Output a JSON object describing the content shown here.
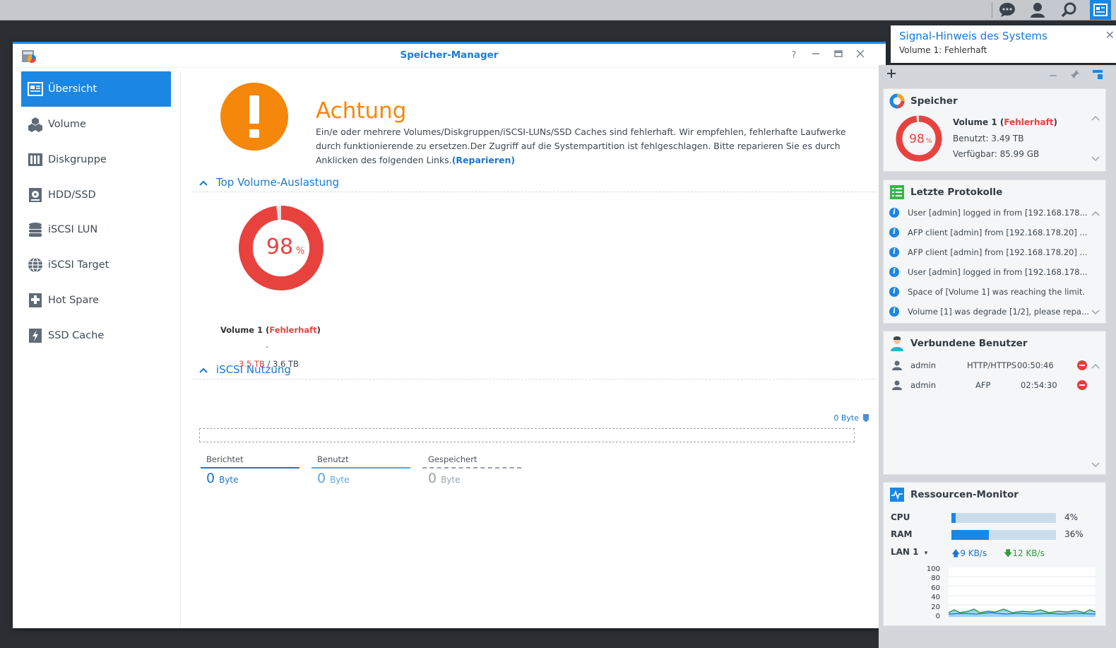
{
  "window": {
    "title": "Speicher-Manager",
    "help": "?"
  },
  "sidebar": {
    "items": [
      {
        "label": "Übersicht",
        "icon": "overview-icon",
        "active": true
      },
      {
        "label": "Volume",
        "icon": "cubes-icon"
      },
      {
        "label": "Diskgruppe",
        "icon": "disk-group-icon"
      },
      {
        "label": "HDD/SSD",
        "icon": "hdd-icon"
      },
      {
        "label": "iSCSI LUN",
        "icon": "database-icon"
      },
      {
        "label": "iSCSI Target",
        "icon": "globe-icon"
      },
      {
        "label": "Hot Spare",
        "icon": "hot-spare-icon"
      },
      {
        "label": "SSD Cache",
        "icon": "ssd-cache-icon"
      }
    ]
  },
  "warning": {
    "heading": "Achtung",
    "text": "Ein/e oder mehrere Volumes/Diskgruppen/iSCSI-LUNs/SSD Caches sind fehlerhaft. Wir empfehlen, fehlerhafte Laufwerke durch funktionierende zu ersetzen.Der Zugriff auf die Systempartition ist fehlgeschlagen. Bitte reparieren Sie es durch Anklicken des folgenden Links.",
    "link": "(Reparieren)",
    "color": "#f5870b"
  },
  "volume_usage": {
    "heading": "Top Volume-Auslastung",
    "percent": 98,
    "percent_value": "98",
    "percent_sign": "%",
    "name": "Volume 1",
    "status": "Fehlerhaft",
    "dash": "-",
    "used": "3.5 TB",
    "separator": " / ",
    "total": "3.6 TB",
    "color": "#e8423f"
  },
  "iscsi": {
    "heading": "iSCSI Nutzung",
    "top_value": "0 Byte",
    "legend": [
      {
        "label": "Berichtet",
        "value": "0",
        "unit": "Byte",
        "color": "#1b76d1"
      },
      {
        "label": "Benutzt",
        "value": "0",
        "unit": "Byte",
        "color": "#5aa6e6"
      },
      {
        "label": "Gespeichert",
        "value": "0",
        "unit": "Byte",
        "color": "#9aa2aa"
      }
    ]
  },
  "notification": {
    "title": "Signal-Hinweis des Systems",
    "message": "Volume 1: Fehlerhaft"
  },
  "widgets": {
    "storage": {
      "title": "Speicher",
      "percent": 98,
      "percent_value": "98",
      "percent_sign": "%",
      "volume": "Volume 1",
      "status": "Fehlerhaft",
      "used": "Benutzt: 3.49 TB",
      "free": "Verfügbar: 85.99 GB"
    },
    "logs": {
      "title": "Letzte Protokolle",
      "items": [
        "User [admin] logged in from [192.168.178...",
        "AFP client [admin] from [192.168.178.20] ...",
        "AFP client [admin] from [192.168.178.20] ...",
        "User [admin] logged in from [192.168.178...",
        "Space of [Volume 1] was reaching the limit.",
        "Volume [1] was degrade [1/2], please repa..."
      ]
    },
    "users": {
      "title": "Verbundene Benutzer",
      "rows": [
        {
          "user": "admin",
          "protocol": "HTTP/HTTPS",
          "time": "00:50:46"
        },
        {
          "user": "admin",
          "protocol": "AFP",
          "time": "02:54:30"
        }
      ]
    },
    "resources": {
      "title": "Ressourcen-Monitor",
      "cpu_label": "CPU",
      "cpu_pct": "4%",
      "cpu_value": 0.04,
      "ram_label": "RAM",
      "ram_pct": "36%",
      "ram_value": 0.36,
      "lan_label": "LAN 1",
      "upload": "9 KB/s",
      "download": "12 KB/s",
      "y_ticks": [
        "100",
        "80",
        "60",
        "40",
        "20",
        "0"
      ]
    }
  }
}
